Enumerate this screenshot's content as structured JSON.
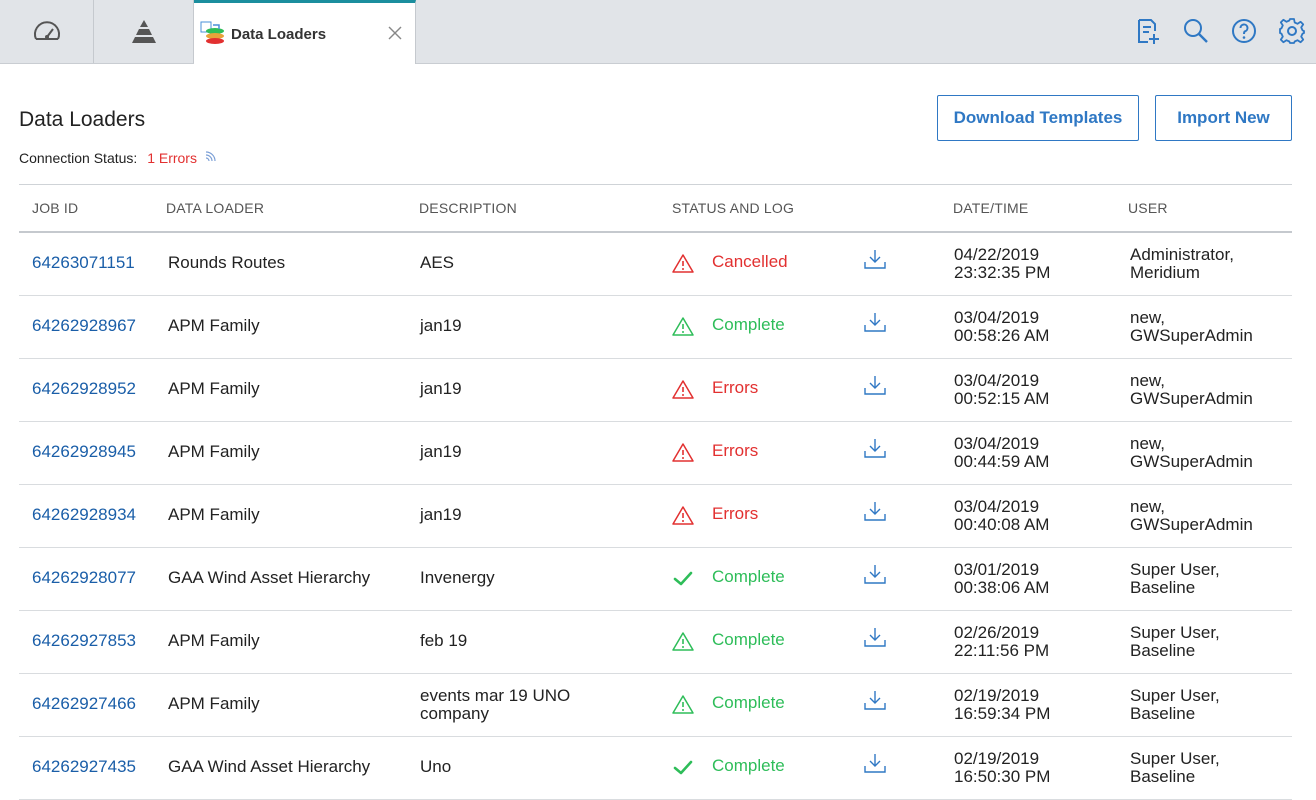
{
  "tabs": {
    "active_label": "Data Loaders",
    "icons": [
      "dashboard-gauge-icon",
      "hierarchy-pyramid-icon"
    ]
  },
  "toolbar_icons": [
    "new-document-icon",
    "search-icon",
    "help-icon",
    "settings-gear-icon"
  ],
  "page": {
    "title": "Data Loaders",
    "connection_label": "Connection Status:",
    "connection_value": "1 Errors"
  },
  "buttons": {
    "download_templates": "Download Templates",
    "import_new": "Import New"
  },
  "colors": {
    "accent": "#2f78c4",
    "link": "#1a5ea8",
    "error": "#e23030",
    "success": "#2ebd59",
    "tab_accent": "#1b8e9e"
  },
  "table": {
    "headers": {
      "job_id": "JOB ID",
      "data_loader": "DATA LOADER",
      "description": "DESCRIPTION",
      "status": "STATUS AND LOG",
      "datetime": "DATE/TIME",
      "user": "USER"
    },
    "rows": [
      {
        "job_id": "64263071151",
        "loader": "Rounds Routes",
        "desc1": "AES",
        "desc2": "",
        "status": "Cancelled",
        "status_kind": "error",
        "date": "04/22/2019",
        "time": "23:32:35 PM",
        "user1": "Administrator,",
        "user2": "Meridium"
      },
      {
        "job_id": "64262928967",
        "loader": "APM Family",
        "desc1": "jan19",
        "desc2": "",
        "status": "Complete",
        "status_kind": "warning",
        "date": "03/04/2019",
        "time": "00:58:26 AM",
        "user1": "new,",
        "user2": "GWSuperAdmin"
      },
      {
        "job_id": "64262928952",
        "loader": "APM Family",
        "desc1": "jan19",
        "desc2": "",
        "status": "Errors",
        "status_kind": "error",
        "date": "03/04/2019",
        "time": "00:52:15 AM",
        "user1": "new,",
        "user2": "GWSuperAdmin"
      },
      {
        "job_id": "64262928945",
        "loader": "APM Family",
        "desc1": "jan19",
        "desc2": "",
        "status": "Errors",
        "status_kind": "error",
        "date": "03/04/2019",
        "time": "00:44:59 AM",
        "user1": "new,",
        "user2": "GWSuperAdmin"
      },
      {
        "job_id": "64262928934",
        "loader": "APM Family",
        "desc1": "jan19",
        "desc2": "",
        "status": "Errors",
        "status_kind": "error",
        "date": "03/04/2019",
        "time": "00:40:08 AM",
        "user1": "new,",
        "user2": "GWSuperAdmin"
      },
      {
        "job_id": "64262928077",
        "loader": "GAA Wind Asset Hierarchy",
        "desc1": "Invenergy",
        "desc2": "",
        "status": "Complete",
        "status_kind": "success",
        "date": "03/01/2019",
        "time": "00:38:06 AM",
        "user1": "Super User,",
        "user2": "Baseline"
      },
      {
        "job_id": "64262927853",
        "loader": "APM Family",
        "desc1": "feb 19",
        "desc2": "",
        "status": "Complete",
        "status_kind": "warning",
        "date": "02/26/2019",
        "time": "22:11:56 PM",
        "user1": "Super User,",
        "user2": "Baseline"
      },
      {
        "job_id": "64262927466",
        "loader": "APM Family",
        "desc1": "events mar 19 UNO",
        "desc2": "company",
        "status": "Complete",
        "status_kind": "warning",
        "date": "02/19/2019",
        "time": "16:59:34 PM",
        "user1": "Super User,",
        "user2": "Baseline"
      },
      {
        "job_id": "64262927435",
        "loader": "GAA Wind Asset Hierarchy",
        "desc1": "Uno",
        "desc2": "",
        "status": "Complete",
        "status_kind": "success",
        "date": "02/19/2019",
        "time": "16:50:30 PM",
        "user1": "Super User,",
        "user2": "Baseline"
      }
    ]
  }
}
